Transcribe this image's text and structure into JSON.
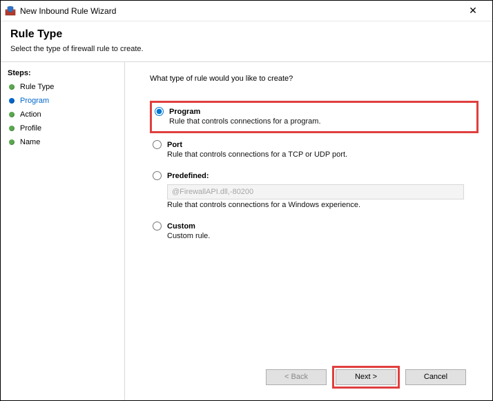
{
  "window": {
    "title": "New Inbound Rule Wizard"
  },
  "header": {
    "title": "Rule Type",
    "subtitle": "Select the type of firewall rule to create."
  },
  "sidebar": {
    "title": "Steps:",
    "items": [
      {
        "label": "Rule Type"
      },
      {
        "label": "Program"
      },
      {
        "label": "Action"
      },
      {
        "label": "Profile"
      },
      {
        "label": "Name"
      }
    ],
    "current_index": 1
  },
  "main": {
    "question": "What type of rule would you like to create?",
    "options": {
      "program": {
        "label": "Program",
        "desc": "Rule that controls connections for a program."
      },
      "port": {
        "label": "Port",
        "desc": "Rule that controls connections for a TCP or UDP port."
      },
      "predefined": {
        "label": "Predefined:",
        "select_value": "@FirewallAPI.dll,-80200",
        "desc": "Rule that controls connections for a Windows experience."
      },
      "custom": {
        "label": "Custom",
        "desc": "Custom rule."
      }
    },
    "selected": "program"
  },
  "footer": {
    "back": "< Back",
    "next": "Next >",
    "cancel": "Cancel"
  }
}
